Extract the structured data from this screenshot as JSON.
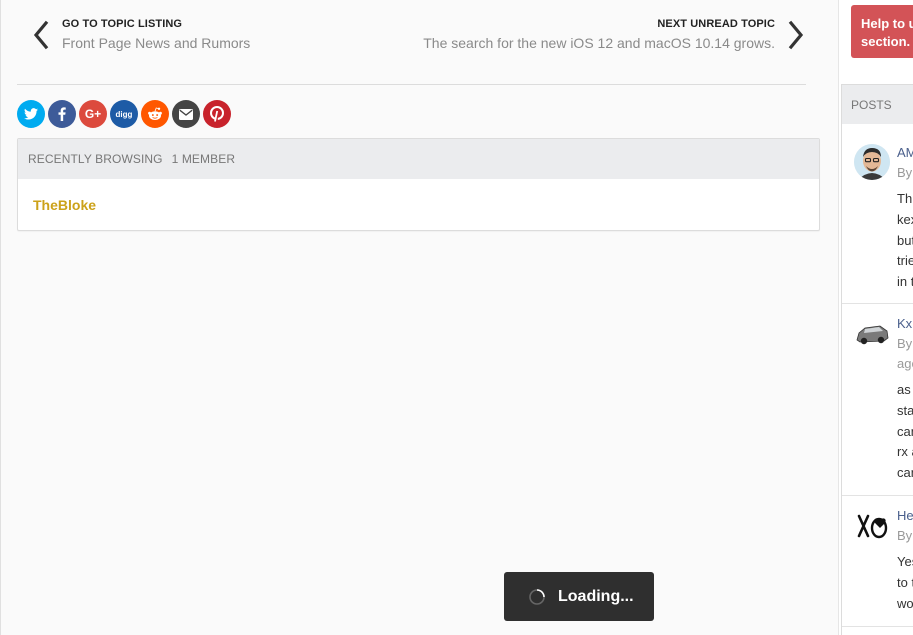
{
  "topic_nav": {
    "prev": {
      "kicker": "GO TO TOPIC LISTING",
      "title": "Front Page News and Rumors",
      "icon": "chevron-left-icon"
    },
    "next": {
      "kicker": "NEXT UNREAD TOPIC",
      "title": "The search for the new iOS 12 and macOS 10.14 grows.",
      "icon": "chevron-right-icon"
    }
  },
  "share": [
    {
      "name": "twitter",
      "color": "#00abf0"
    },
    {
      "name": "facebook",
      "color": "#3d5b99"
    },
    {
      "name": "google-plus",
      "color": "#dc4a3d"
    },
    {
      "name": "digg",
      "color": "#1d5ba6"
    },
    {
      "name": "reddit",
      "color": "#ff5700"
    },
    {
      "name": "email",
      "color": "#444444"
    },
    {
      "name": "pinterest",
      "color": "#c8232c"
    }
  ],
  "recently_browsing": {
    "label": "RECENTLY BROWSING",
    "count": "1 MEMBER",
    "members": [
      "TheBloke"
    ]
  },
  "loading": {
    "text": "Loading..."
  },
  "sidebar": {
    "help_box": {
      "line1": "Help to u",
      "line2": "section."
    },
    "posts_widget": {
      "header": "POSTS",
      "posts": [
        {
          "title": "AM",
          "by": "By",
          "lines": [
            "Th",
            "kex",
            "but",
            "trie",
            "in t"
          ]
        },
        {
          "title": "Kx",
          "by": "By",
          "meta2": "age",
          "lines": [
            "as",
            "sta",
            "can",
            "rx a",
            "can"
          ]
        },
        {
          "title": "He",
          "by": "By",
          "lines": [
            "Yes",
            "to t",
            "wo"
          ]
        }
      ]
    }
  },
  "colors": {
    "accent_member": "#cca21a",
    "help_box": "#d35357",
    "loading_bg": "#2f2f2f"
  }
}
